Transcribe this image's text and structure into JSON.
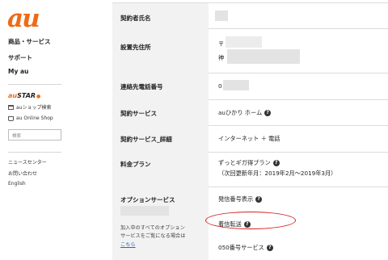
{
  "sidebar": {
    "logo": "au",
    "nav": [
      "商品・サービス",
      "サポート",
      "My au"
    ],
    "star_brand_prefix": "au",
    "star_brand_suffix": "STAR",
    "links": [
      "auショップ検索",
      "au Online Shop"
    ],
    "search_placeholder": "検索",
    "footer_links": [
      "ニュースセンター",
      "お問い合わせ",
      "English"
    ]
  },
  "table": {
    "rows": [
      {
        "label": "契約者氏名",
        "value": ""
      },
      {
        "label": "設置先住所",
        "value_line1": "〒",
        "value_line2": "神"
      },
      {
        "label": "連絡先電話番号",
        "value": "0"
      },
      {
        "label": "契約サービス",
        "value": "auひかり ホーム"
      },
      {
        "label": "契約サービス_詳細",
        "value": "インターネット ＋ 電話"
      },
      {
        "label": "料金プラン",
        "value": "ずっとギガ得プラン",
        "value_sub": "（次回更新年月：2019年2月〜2019年3月）"
      },
      {
        "label": "オプションサービス",
        "note_line1": "加入中のすべてのオプション",
        "note_line2": "サービスをご覧になる場合は",
        "note_link": "こちら",
        "options": [
          "発信番号表示",
          "着信転送",
          "050番号サービス"
        ]
      }
    ],
    "highlighted_option": "着信転送",
    "highlight_color": "#d32020"
  },
  "colors": {
    "brand": "#f06a14",
    "link": "#2a63c9"
  }
}
